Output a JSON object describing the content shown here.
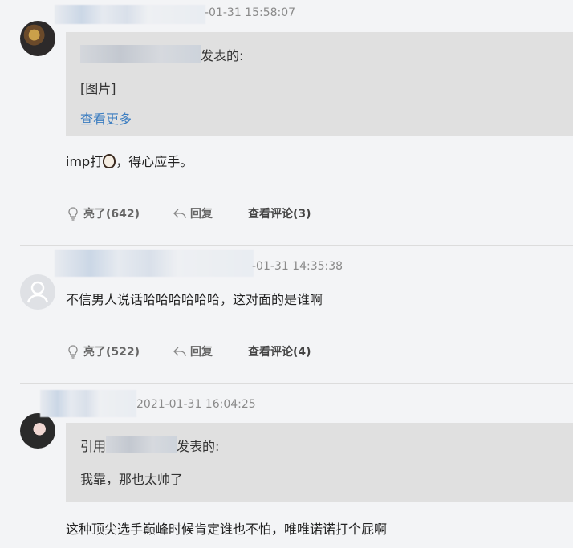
{
  "comments": [
    {
      "timestamp": "-01-31 15:58:07",
      "quote": {
        "author_suffix": "发表的:",
        "content": "[图片]",
        "more_link": "查看更多"
      },
      "text_before": "imp打",
      "text_after": "，得心应手。",
      "like_label": "亮了(642)",
      "reply_label": "回复",
      "view_comments_label": "查看评论(3)"
    },
    {
      "timestamp": "-01-31 14:35:38",
      "text": "不信男人说话哈哈哈哈哈哈，这对面的是谁啊",
      "like_label": "亮了(522)",
      "reply_label": "回复",
      "view_comments_label": "查看评论(4)"
    },
    {
      "timestamp": "2021-01-31 16:04:25",
      "quote": {
        "author_prefix": "引用",
        "author_suffix": "发表的:",
        "content": "我靠，那也太帅了"
      },
      "text": "这种顶尖选手巅峰时候肯定谁也不怕，唯唯诺诺打个屁啊"
    }
  ],
  "icons": {
    "like": "lightbulb-icon",
    "reply": "reply-arrow-icon",
    "emoji": "dog-face-emoji-icon"
  }
}
